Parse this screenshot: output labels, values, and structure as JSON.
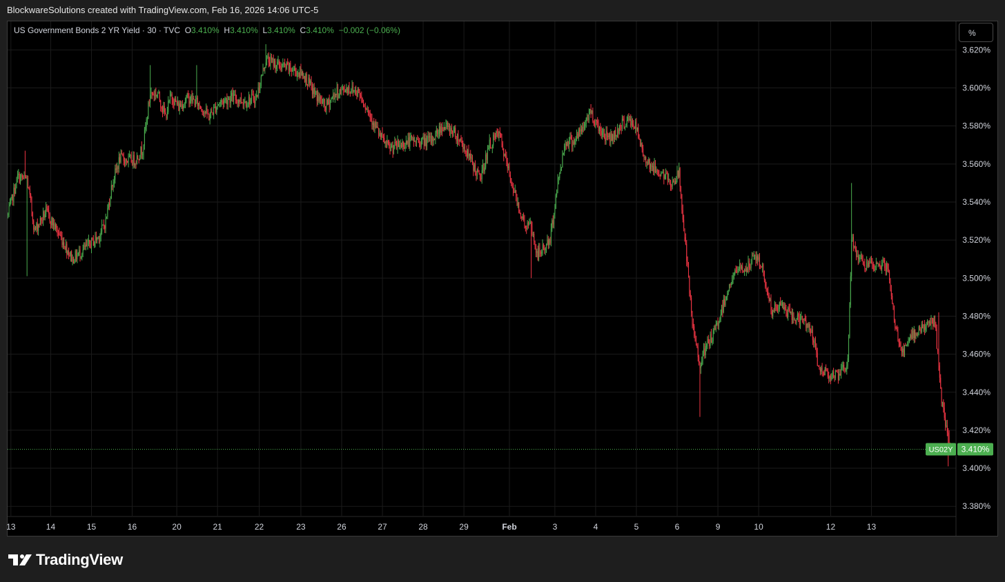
{
  "header": {
    "attribution": "BlockwareSolutions created with TradingView.com, Feb 16, 2026 14:06 UTC-5"
  },
  "legend": {
    "symbol_desc": "US Government Bonds 2 YR Yield · 30 · TVC",
    "o_label": "O",
    "o_value": "3.410%",
    "h_label": "H",
    "h_value": "3.410%",
    "l_label": "L",
    "l_value": "3.410%",
    "c_label": "C",
    "c_value": "3.410%",
    "change": "−0.002 (−0.06%)"
  },
  "scale_button": "%",
  "price_tag": {
    "symbol": "US02Y",
    "value": "3.410%"
  },
  "footer": {
    "brand": "TradingView"
  },
  "colors": {
    "up": "#4caf50",
    "down": "#f23645",
    "bg": "#000000",
    "grid": "#1b1b1b",
    "text": "#d1d4dc"
  },
  "chart_data": {
    "type": "candlestick",
    "ylim": [
      3.375,
      3.635
    ],
    "y_ticks": [
      3.38,
      3.4,
      3.42,
      3.44,
      3.46,
      3.48,
      3.5,
      3.52,
      3.54,
      3.56,
      3.58,
      3.6,
      3.62
    ],
    "y_tick_labels": [
      "3.380%",
      "3.400%",
      "3.420%",
      "3.440%",
      "3.460%",
      "3.480%",
      "3.500%",
      "3.520%",
      "3.540%",
      "3.560%",
      "3.580%",
      "3.600%",
      "3.620%"
    ],
    "x_labels": [
      "13",
      "14",
      "15",
      "16",
      "20",
      "21",
      "22",
      "23",
      "26",
      "27",
      "28",
      "29",
      "Feb",
      "3",
      "4",
      "5",
      "6",
      "9",
      "10",
      "12",
      "13"
    ],
    "x_label_index": [
      3,
      45,
      88,
      131,
      178,
      221,
      265,
      309,
      352,
      395,
      438,
      481,
      529,
      577,
      620,
      663,
      706,
      749,
      792,
      868,
      911
    ],
    "last_value": 3.41,
    "path": [
      [
        0,
        3.533
      ],
      [
        10,
        3.553
      ],
      [
        20,
        3.552
      ],
      [
        28,
        3.525
      ],
      [
        40,
        3.535
      ],
      [
        55,
        3.522
      ],
      [
        68,
        3.51
      ],
      [
        82,
        3.516
      ],
      [
        96,
        3.522
      ],
      [
        103,
        3.53
      ],
      [
        110,
        3.55
      ],
      [
        118,
        3.563
      ],
      [
        126,
        3.562
      ],
      [
        134,
        3.562
      ],
      [
        142,
        3.568
      ],
      [
        150,
        3.597
      ],
      [
        158,
        3.597
      ],
      [
        166,
        3.585
      ],
      [
        172,
        3.596
      ],
      [
        180,
        3.59
      ],
      [
        190,
        3.595
      ],
      [
        200,
        3.592
      ],
      [
        212,
        3.585
      ],
      [
        222,
        3.592
      ],
      [
        235,
        3.595
      ],
      [
        250,
        3.593
      ],
      [
        262,
        3.595
      ],
      [
        272,
        3.615
      ],
      [
        285,
        3.612
      ],
      [
        298,
        3.61
      ],
      [
        312,
        3.607
      ],
      [
        322,
        3.598
      ],
      [
        335,
        3.59
      ],
      [
        345,
        3.597
      ],
      [
        358,
        3.6
      ],
      [
        370,
        3.598
      ],
      [
        380,
        3.588
      ],
      [
        392,
        3.575
      ],
      [
        402,
        3.568
      ],
      [
        414,
        3.57
      ],
      [
        424,
        3.572
      ],
      [
        434,
        3.572
      ],
      [
        446,
        3.572
      ],
      [
        458,
        3.58
      ],
      [
        468,
        3.578
      ],
      [
        478,
        3.572
      ],
      [
        488,
        3.562
      ],
      [
        498,
        3.552
      ],
      [
        508,
        3.57
      ],
      [
        518,
        3.576
      ],
      [
        526,
        3.56
      ],
      [
        536,
        3.542
      ],
      [
        545,
        3.528
      ],
      [
        552,
        3.527
      ],
      [
        558,
        3.512
      ],
      [
        564,
        3.515
      ],
      [
        572,
        3.52
      ],
      [
        580,
        3.55
      ],
      [
        588,
        3.572
      ],
      [
        596,
        3.572
      ],
      [
        606,
        3.578
      ],
      [
        614,
        3.588
      ],
      [
        622,
        3.58
      ],
      [
        630,
        3.575
      ],
      [
        638,
        3.574
      ],
      [
        646,
        3.58
      ],
      [
        654,
        3.583
      ],
      [
        662,
        3.58
      ],
      [
        670,
        3.565
      ],
      [
        680,
        3.558
      ],
      [
        690,
        3.555
      ],
      [
        700,
        3.55
      ],
      [
        708,
        3.555
      ],
      [
        716,
        3.51
      ],
      [
        722,
        3.475
      ],
      [
        730,
        3.455
      ],
      [
        738,
        3.465
      ],
      [
        746,
        3.472
      ],
      [
        754,
        3.485
      ],
      [
        760,
        3.495
      ],
      [
        770,
        3.505
      ],
      [
        780,
        3.505
      ],
      [
        788,
        3.512
      ],
      [
        796,
        3.505
      ],
      [
        806,
        3.482
      ],
      [
        816,
        3.486
      ],
      [
        826,
        3.48
      ],
      [
        836,
        3.478
      ],
      [
        846,
        3.475
      ],
      [
        856,
        3.452
      ],
      [
        866,
        3.45
      ],
      [
        876,
        3.448
      ],
      [
        886,
        3.455
      ],
      [
        890,
        3.52
      ],
      [
        898,
        3.51
      ],
      [
        906,
        3.507
      ],
      [
        914,
        3.505
      ],
      [
        922,
        3.508
      ],
      [
        928,
        3.505
      ],
      [
        936,
        3.475
      ],
      [
        944,
        3.46
      ],
      [
        952,
        3.468
      ],
      [
        960,
        3.473
      ],
      [
        970,
        3.475
      ],
      [
        978,
        3.478
      ],
      [
        984,
        3.44
      ],
      [
        990,
        3.42
      ],
      [
        994,
        3.41
      ]
    ],
    "spikes": [
      {
        "i": 18,
        "high": 3.567
      },
      {
        "i": 20,
        "low": 3.501
      },
      {
        "i": 150,
        "high": 3.612
      },
      {
        "i": 199,
        "high": 3.612
      },
      {
        "i": 272,
        "high": 3.623
      },
      {
        "i": 552,
        "low": 3.5
      },
      {
        "i": 730,
        "low": 3.427
      },
      {
        "i": 890,
        "high": 3.55
      },
      {
        "i": 982,
        "high": 3.482
      },
      {
        "i": 992,
        "low": 3.401
      }
    ],
    "spike_rule": "first wick above/below the 'path' series at index i"
  }
}
